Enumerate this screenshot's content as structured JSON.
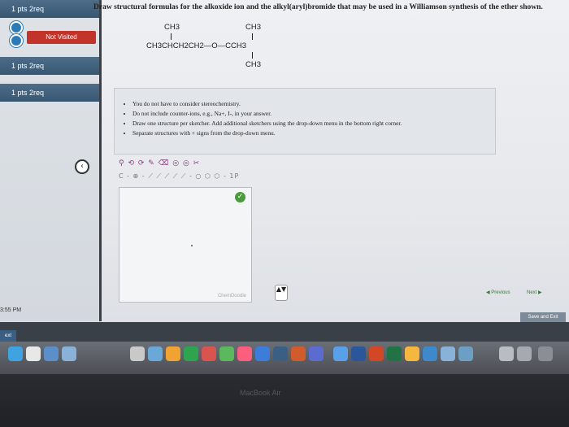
{
  "sidebar": {
    "items": [
      {
        "label": "1 pts  2req"
      },
      {
        "label": "1 pts  2req"
      },
      {
        "label": "1 pts  2req"
      }
    ],
    "status_badge": "Not Visited",
    "time": "3:55 PM"
  },
  "question": {
    "text": "Draw structural formulas for the alkoxide ion and the alkyl(aryl)bromide that may be used in a Williamson synthesis of the ether shown.",
    "structure": {
      "top_left": "CH3",
      "top_right": "CH3",
      "main_chain": "CH3CHCH2CH2—O—CCH3",
      "bottom": "CH3"
    }
  },
  "instructions": [
    "You do not have to consider stereochemistry.",
    "Do not include counter-ions, e.g., Na+, I-, in your answer.",
    "Draw one structure per sketcher. Add additional sketchers using the drop-down menu in the bottom right corner.",
    "Separate structures with + signs from the drop-down menu."
  ],
  "sketcher": {
    "toolbar_row1": "⚲ ⟲ ⟳ ✎ ⌫ ◎ ◎ ✂",
    "toolbar_row2": "C - ⊕ - ⟋ ⟋ ⟋ ⟋ ⟋ - ○ ⬡ ⬡ - 1P",
    "watermark": "ChemDoodle",
    "stepper": "▲▼"
  },
  "nav": {
    "previous": "Previous",
    "next": "Next",
    "save_exit": "Save and Exit"
  },
  "device": {
    "label": "MacBook Air"
  },
  "colors": {
    "sidebar_accent": "#365672",
    "badge_red": "#c2332a",
    "ok_green": "#4a9b3b"
  }
}
